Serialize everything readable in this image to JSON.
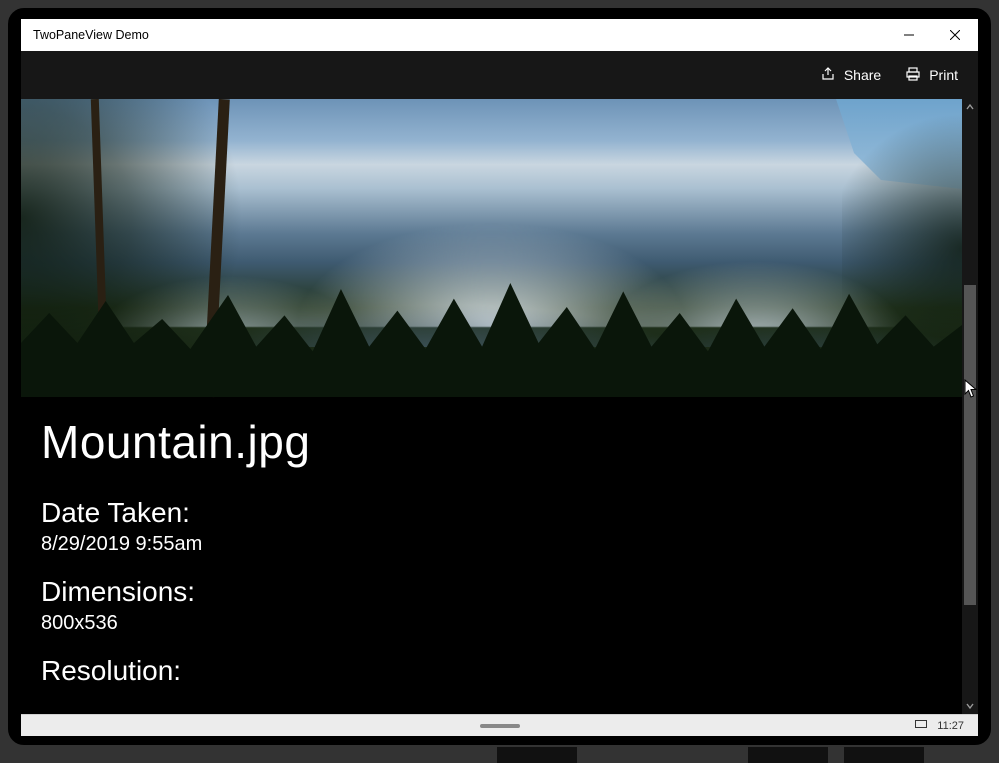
{
  "window": {
    "title": "TwoPaneView Demo"
  },
  "commandbar": {
    "share_label": "Share",
    "print_label": "Print"
  },
  "details": {
    "filename": "Mountain.jpg",
    "date_label": "Date Taken:",
    "date_value": "8/29/2019 9:55am",
    "dimensions_label": "Dimensions:",
    "dimensions_value": "800x536",
    "resolution_label": "Resolution:"
  },
  "taskbar": {
    "clock": "11:27"
  }
}
